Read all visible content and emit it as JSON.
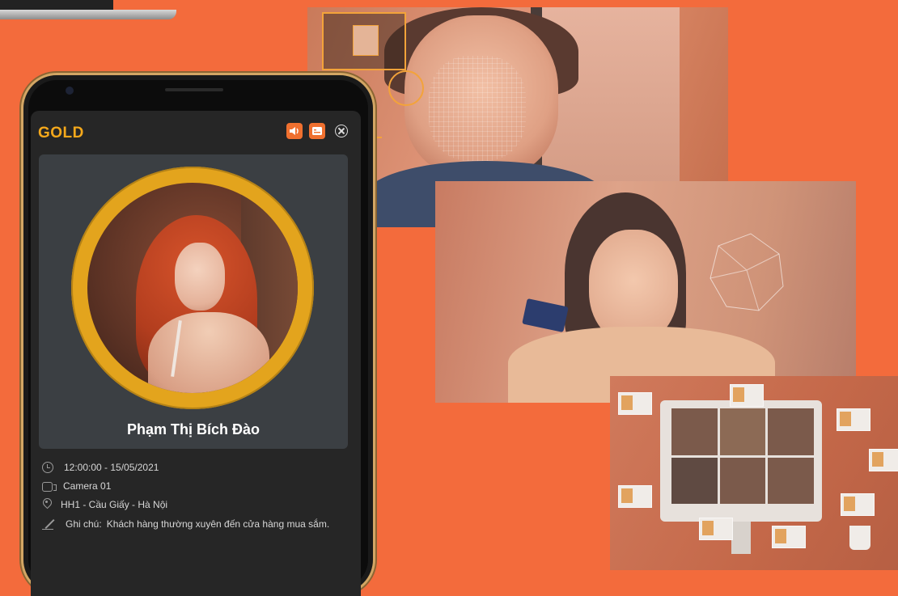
{
  "customer_card": {
    "tier": "GOLD",
    "name": "Phạm Thị Bích Đào",
    "time": "12:00:00 - 15/05/2021",
    "camera": "Camera 01",
    "location": "HH1 - Cầu Giấy - Hà Nội",
    "note_label": "Ghi chú:",
    "note": "Khách hàng thường xuyên đến cửa hàng mua sắm.",
    "accent_color": "#f4a81b",
    "button_color": "#f0702f"
  },
  "icons": {
    "sound": "speaker-icon",
    "card": "id-card-icon",
    "close": "close-circle-icon",
    "time": "clock-icon",
    "camera": "video-camera-icon",
    "location": "map-pin-icon",
    "note": "pen-icon"
  },
  "background_color": "#f36b3c"
}
